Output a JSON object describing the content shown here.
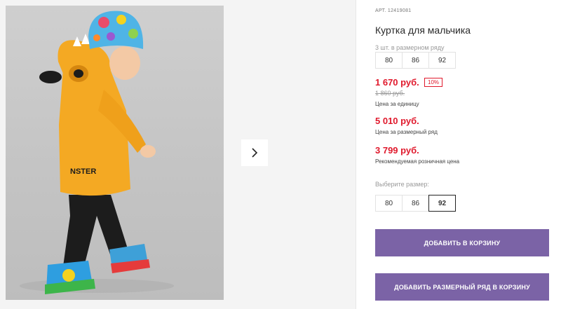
{
  "gallery": {
    "photo_alt": "Куртка для мальчика",
    "print_text": "NSTER",
    "next_icon": "chevron-right-icon"
  },
  "product": {
    "sku_label": "АРТ. 12419081",
    "title": "Куртка для мальчика",
    "range_label": "3 шт. в размерном ряду",
    "range_sizes": [
      "80",
      "86",
      "92"
    ],
    "price_unit": "1 670 руб.",
    "discount": "10%",
    "price_old": "1 860 руб.",
    "price_unit_note": "Цена за единицу",
    "price_range": "5 010 руб.",
    "price_range_note": "Цена за размерный ряд",
    "price_recommended": "3 799 руб.",
    "price_recommended_note": "Рекомендуемая розничная цена",
    "choose_size_label": "Выберите размер:",
    "sizes": [
      "80",
      "86",
      "92"
    ],
    "selected_size": "92",
    "add_to_cart": "ДОБАВИТЬ В КОРЗИНУ",
    "add_range_to_cart": "ДОБАВИТЬ РАЗМЕРНЫЙ РЯД В КОРЗИНУ"
  },
  "colors": {
    "accent": "#7b63a6",
    "price": "#e0192c",
    "jacket": "#f4a923"
  }
}
